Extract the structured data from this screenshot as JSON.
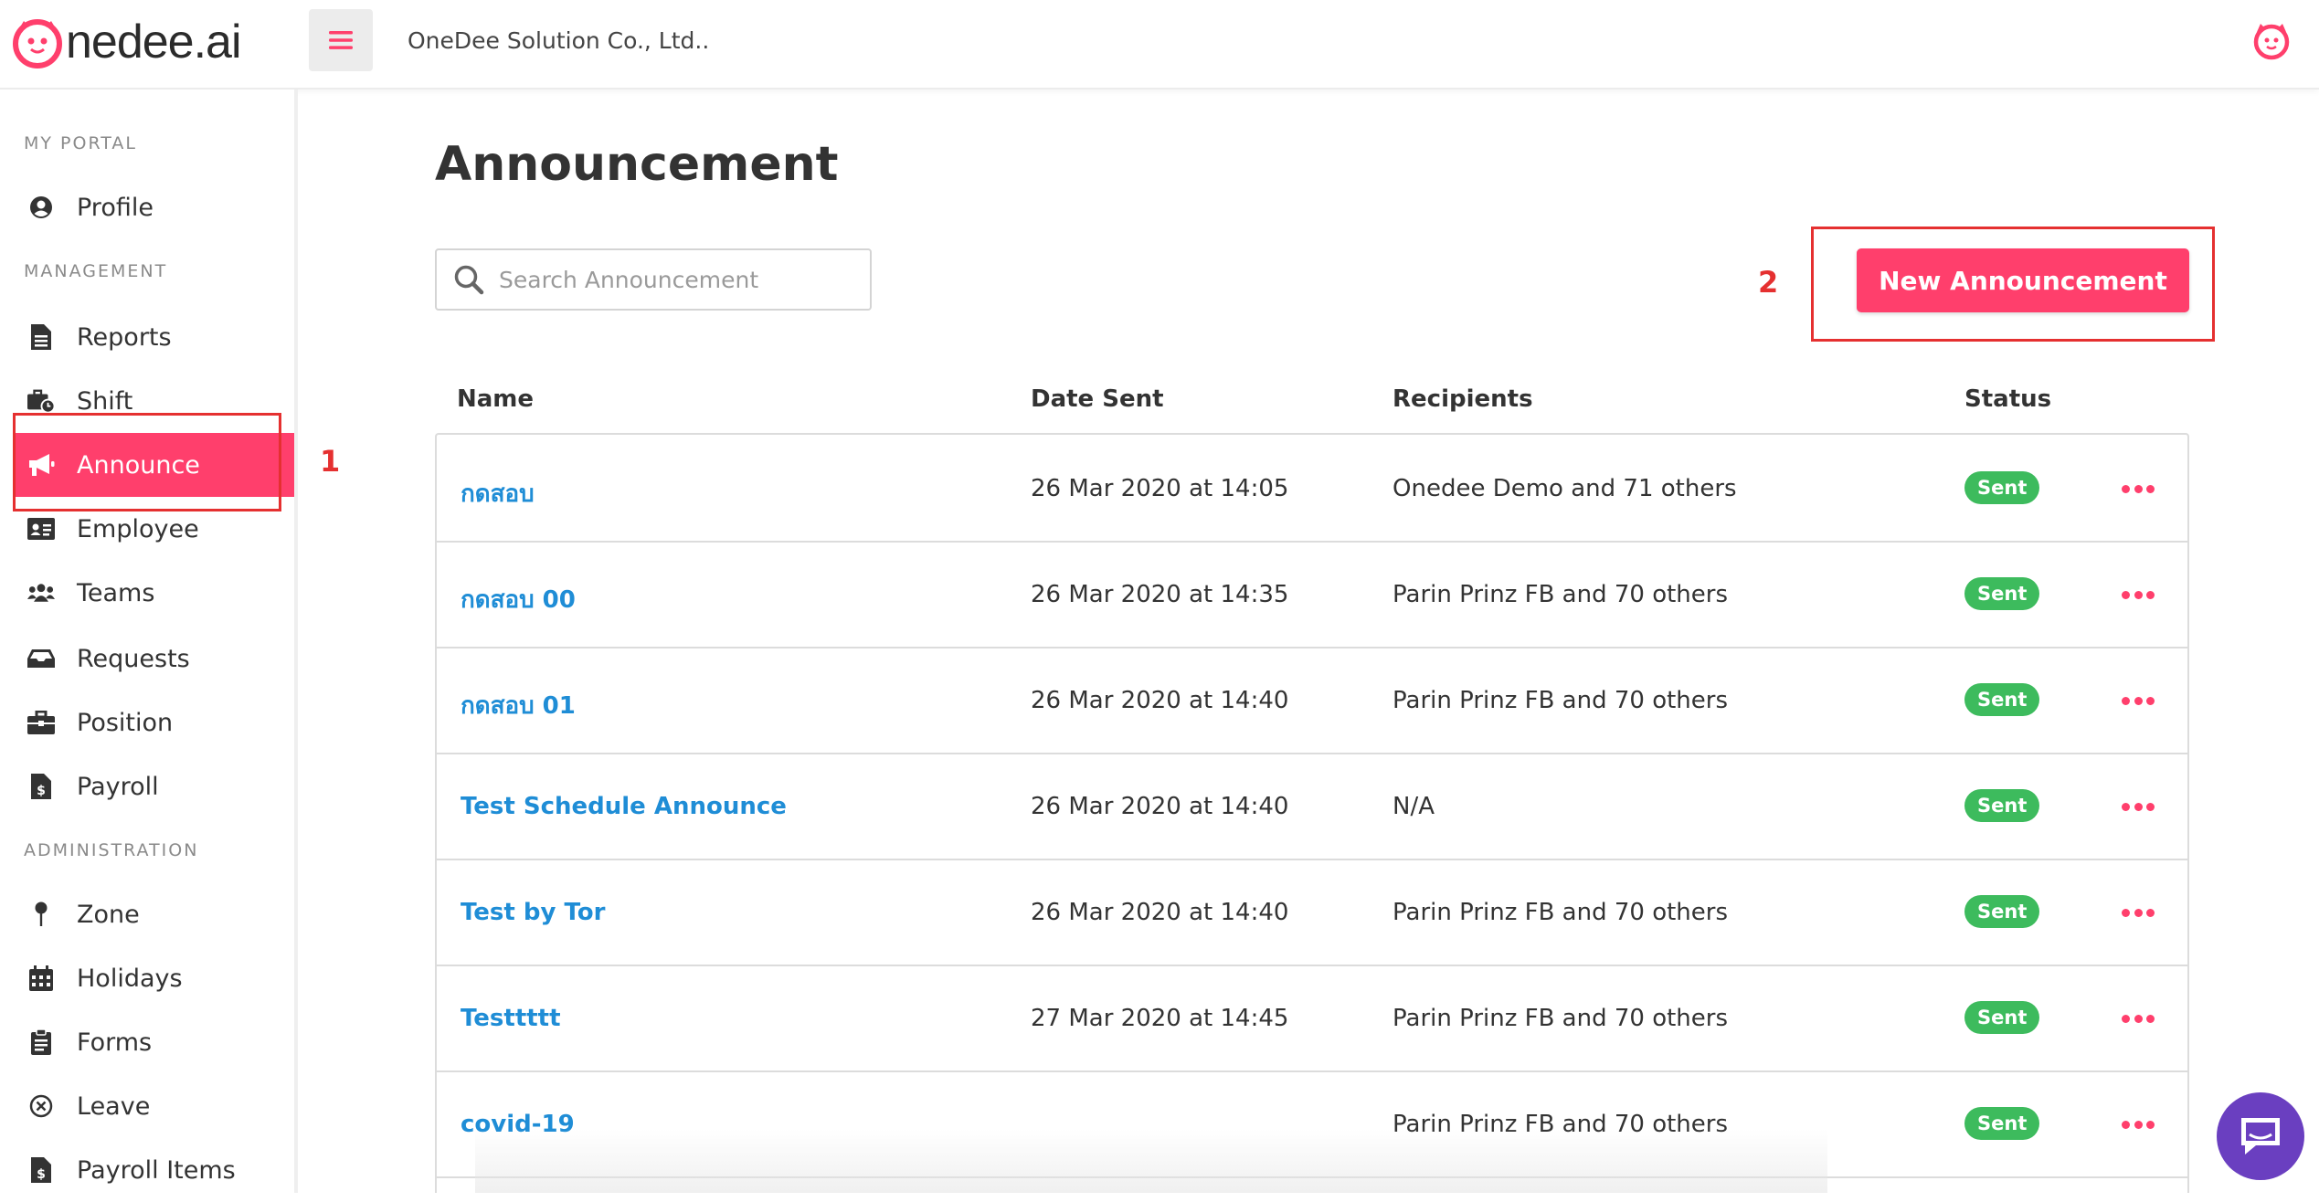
{
  "header": {
    "logo_text": "nedee.ai",
    "company": "OneDee Solution Co., Ltd.."
  },
  "sidebar": {
    "sections": [
      {
        "label": "MY PORTAL"
      },
      {
        "label": "MANAGEMENT"
      },
      {
        "label": "ADMINISTRATION"
      }
    ],
    "items": [
      {
        "label": "Profile",
        "icon": "user-circle-icon"
      },
      {
        "label": "Reports",
        "icon": "document-icon"
      },
      {
        "label": "Shift",
        "icon": "briefcase-clock-icon"
      },
      {
        "label": "Announce",
        "icon": "megaphone-icon",
        "active": true
      },
      {
        "label": "Employee",
        "icon": "id-card-icon"
      },
      {
        "label": "Teams",
        "icon": "users-icon"
      },
      {
        "label": "Requests",
        "icon": "inbox-icon"
      },
      {
        "label": "Position",
        "icon": "briefcase-icon"
      },
      {
        "label": "Payroll",
        "icon": "invoice-dollar-icon"
      },
      {
        "label": "Zone",
        "icon": "map-pin-icon"
      },
      {
        "label": "Holidays",
        "icon": "calendar-icon"
      },
      {
        "label": "Forms",
        "icon": "clipboard-icon"
      },
      {
        "label": "Leave",
        "icon": "times-circle-icon"
      },
      {
        "label": "Payroll Items",
        "icon": "invoice-dollar-icon"
      }
    ]
  },
  "annotations": {
    "one": "1",
    "two": "2",
    "color": "#e53030"
  },
  "main": {
    "title": "Announcement",
    "search_placeholder": "Search Announcement",
    "new_button": "New Announcement",
    "columns": [
      "Name",
      "Date Sent",
      "Recipients",
      "Status"
    ],
    "rows": [
      {
        "name": "กดสอบ",
        "date": "26 Mar 2020 at 14:05",
        "recipients": "Onedee Demo and 71 others",
        "status": "Sent"
      },
      {
        "name": "กดสอบ 00",
        "date": "26 Mar 2020 at 14:35",
        "recipients": "Parin Prinz FB and 70 others",
        "status": "Sent"
      },
      {
        "name": "กดสอบ 01",
        "date": "26 Mar 2020 at 14:40",
        "recipients": "Parin Prinz FB and 70 others",
        "status": "Sent"
      },
      {
        "name": "Test Schedule Announce",
        "date": "26 Mar 2020 at 14:40",
        "recipients": "N/A",
        "status": "Sent"
      },
      {
        "name": "Test by Tor",
        "date": "26 Mar 2020 at 14:40",
        "recipients": "Parin Prinz FB and 70 others",
        "status": "Sent"
      },
      {
        "name": "Testtttt",
        "date": "27 Mar 2020 at 14:45",
        "recipients": "Parin Prinz FB and 70 others",
        "status": "Sent"
      },
      {
        "name": "covid-19",
        "date": "",
        "recipients": "Parin Prinz FB and 70 others",
        "status": "Sent"
      }
    ]
  },
  "colors": {
    "accent": "#ff3f6c",
    "link": "#1f8dd6",
    "status_sent": "#3dbb5d",
    "chat": "#6a3fc0"
  }
}
